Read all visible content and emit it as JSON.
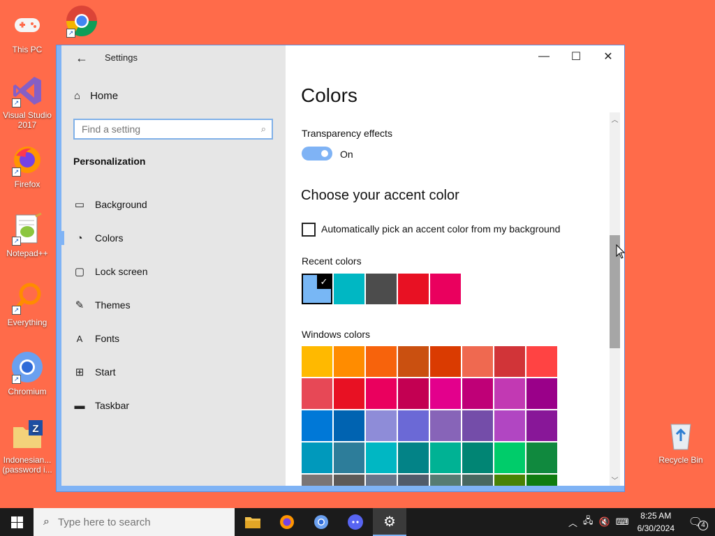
{
  "desktop": {
    "icons": [
      {
        "label": "This PC",
        "icon": "gamepad-icon"
      },
      {
        "label": "Visual Studio 2017",
        "icon": "visual-studio-icon"
      },
      {
        "label": "Firefox",
        "icon": "firefox-icon"
      },
      {
        "label": "Notepad++",
        "icon": "notepadpp-icon"
      },
      {
        "label": "Everything",
        "icon": "everything-icon"
      },
      {
        "label": "Chromium",
        "icon": "chromium-icon"
      },
      {
        "label": "Indonesian... (password i...",
        "icon": "zip-folder-icon"
      },
      {
        "label": "Google Chrome",
        "icon": "chrome-icon"
      },
      {
        "label": "Recycle Bin",
        "icon": "recycle-bin-icon"
      }
    ]
  },
  "window": {
    "app_title": "Settings",
    "home_label": "Home",
    "search_placeholder": "Find a setting",
    "section_title": "Personalization",
    "nav": [
      "Background",
      "Colors",
      "Lock screen",
      "Themes",
      "Fonts",
      "Start",
      "Taskbar"
    ],
    "active_nav": "Colors"
  },
  "content": {
    "page_title": "Colors",
    "transparency_label": "Transparency effects",
    "transparency_state": "On",
    "accent_heading": "Choose your accent color",
    "auto_pick_label": "Automatically pick an accent color from my background",
    "recent_label": "Recent colors",
    "recent_colors": [
      "#78b7f5",
      "#00b7c3",
      "#4c4c4c",
      "#e81123",
      "#ea005e"
    ],
    "windows_label": "Windows colors",
    "windows_colors": [
      "#ffb900",
      "#ff8c00",
      "#f7630c",
      "#ca5010",
      "#da3b01",
      "#ef6950",
      "#d13438",
      "#ff4343",
      "#e74856",
      "#e81123",
      "#ea005e",
      "#c30052",
      "#e3008c",
      "#bf0077",
      "#c239b3",
      "#9a0089",
      "#0078d7",
      "#0063b1",
      "#8e8cd8",
      "#6b69d6",
      "#8764b8",
      "#744da9",
      "#b146c2",
      "#881798",
      "#0099bc",
      "#2d7d9a",
      "#00b7c3",
      "#038387",
      "#00b294",
      "#018574",
      "#00cc6a",
      "#10893e",
      "#7a7574",
      "#5d5a58",
      "#68768a",
      "#515c6b",
      "#567c73",
      "#486860",
      "#498205",
      "#107c10"
    ]
  },
  "taskbar": {
    "search_placeholder": "Type here to search",
    "time": "8:25 AM",
    "date": "6/30/2024",
    "notification_count": "4"
  }
}
